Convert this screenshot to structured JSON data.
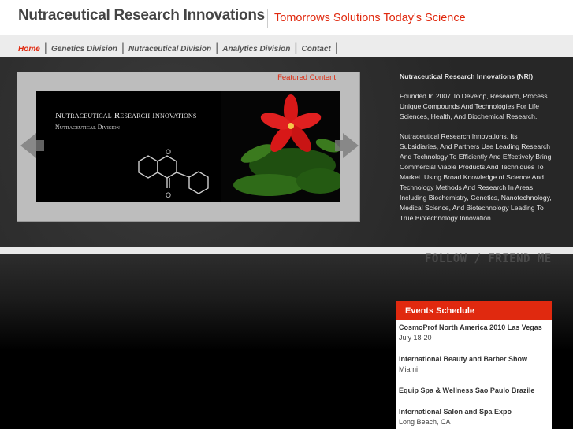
{
  "header": {
    "brand": "Nutraceutical Research Innovations",
    "tagline": "Tomorrows Solutions Today's Science"
  },
  "nav": {
    "items": [
      "Home",
      "Genetics Division",
      "Nutraceutical Division",
      "Analytics Division",
      "Contact"
    ]
  },
  "featured": {
    "label": "Featured Content",
    "slide_title": "Nutraceutical Research Innovations",
    "slide_subtitle": "Nutraceutical Division"
  },
  "about": {
    "title": "Nutraceutical Research Innovations (NRI)",
    "paragraph1": "Founded In 2007 To Develop, Research, Process Unique Compounds And Technologies For Life Sciences, Health, And Biochemical Research.",
    "paragraph2": "Nutraceutical Research Innovations, Its Subsidiaries, And Partners Use Leading Research And Technology To Efficiently And Effectively Bring Commercial Viable Products And Techniques To Market. Using Broad Knowledge of Science And Technology Methods And Research In Areas Including Biochemistry, Genetics, Nanotechnology, Medical Science, And Biotechnology Leading To True Biotechnology Innovation."
  },
  "social": {
    "label": "FOLLOW / FRIEND ME"
  },
  "events": {
    "title": "Events Schedule",
    "items": [
      {
        "name": "CosmoProf North America 2010 Las Vegas",
        "detail": "July 18-20"
      },
      {
        "name": "International Beauty and Barber Show",
        "detail": "Miami"
      },
      {
        "name": "Equip Spa & Wellness Sao Paulo Brazile",
        "detail": ""
      },
      {
        "name": "International Salon and Spa Expo",
        "detail": "Long Beach, CA"
      }
    ]
  },
  "colors": {
    "accent": "#e0290f",
    "background": "#000000"
  }
}
